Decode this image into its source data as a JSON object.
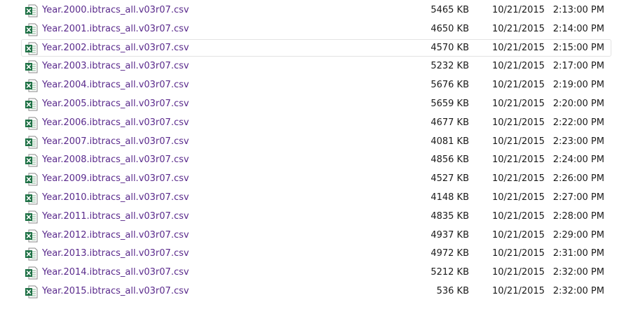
{
  "files": [
    {
      "name": "Year.2000.ibtracs_all.v03r07.csv",
      "size": "5465 KB",
      "date": "10/21/2015",
      "time": "2:13:00 PM",
      "icon": "excel-csv-icon"
    },
    {
      "name": "Year.2001.ibtracs_all.v03r07.csv",
      "size": "4650 KB",
      "date": "10/21/2015",
      "time": "2:14:00 PM",
      "icon": "excel-csv-icon"
    },
    {
      "name": "Year.2002.ibtracs_all.v03r07.csv",
      "size": "4570 KB",
      "date": "10/21/2015",
      "time": "2:15:00 PM",
      "icon": "excel-csv-icon",
      "hovered": true
    },
    {
      "name": "Year.2003.ibtracs_all.v03r07.csv",
      "size": "5232 KB",
      "date": "10/21/2015",
      "time": "2:17:00 PM",
      "icon": "excel-csv-icon"
    },
    {
      "name": "Year.2004.ibtracs_all.v03r07.csv",
      "size": "5676 KB",
      "date": "10/21/2015",
      "time": "2:19:00 PM",
      "icon": "excel-csv-icon"
    },
    {
      "name": "Year.2005.ibtracs_all.v03r07.csv",
      "size": "5659 KB",
      "date": "10/21/2015",
      "time": "2:20:00 PM",
      "icon": "excel-csv-icon"
    },
    {
      "name": "Year.2006.ibtracs_all.v03r07.csv",
      "size": "4677 KB",
      "date": "10/21/2015",
      "time": "2:22:00 PM",
      "icon": "excel-csv-icon"
    },
    {
      "name": "Year.2007.ibtracs_all.v03r07.csv",
      "size": "4081 KB",
      "date": "10/21/2015",
      "time": "2:23:00 PM",
      "icon": "excel-csv-icon"
    },
    {
      "name": "Year.2008.ibtracs_all.v03r07.csv",
      "size": "4856 KB",
      "date": "10/21/2015",
      "time": "2:24:00 PM",
      "icon": "excel-csv-icon"
    },
    {
      "name": "Year.2009.ibtracs_all.v03r07.csv",
      "size": "4527 KB",
      "date": "10/21/2015",
      "time": "2:26:00 PM",
      "icon": "excel-csv-icon"
    },
    {
      "name": "Year.2010.ibtracs_all.v03r07.csv",
      "size": "4148 KB",
      "date": "10/21/2015",
      "time": "2:27:00 PM",
      "icon": "excel-csv-icon"
    },
    {
      "name": "Year.2011.ibtracs_all.v03r07.csv",
      "size": "4835 KB",
      "date": "10/21/2015",
      "time": "2:28:00 PM",
      "icon": "excel-csv-icon"
    },
    {
      "name": "Year.2012.ibtracs_all.v03r07.csv",
      "size": "4937 KB",
      "date": "10/21/2015",
      "time": "2:29:00 PM",
      "icon": "excel-csv-icon"
    },
    {
      "name": "Year.2013.ibtracs_all.v03r07.csv",
      "size": "4972 KB",
      "date": "10/21/2015",
      "time": "2:31:00 PM",
      "icon": "excel-csv-icon"
    },
    {
      "name": "Year.2014.ibtracs_all.v03r07.csv",
      "size": "5212 KB",
      "date": "10/21/2015",
      "time": "2:32:00 PM",
      "icon": "excel-csv-icon"
    },
    {
      "name": "Year.2015.ibtracs_all.v03r07.csv",
      "size": "536 KB",
      "date": "10/21/2015",
      "time": "2:32:00 PM",
      "icon": "excel-csv-icon"
    }
  ],
  "colors": {
    "filename": "#5a2a8c",
    "text": "#1a1a1a",
    "excel_green": "#1e7145",
    "hover_border": "#e3e3e3"
  }
}
